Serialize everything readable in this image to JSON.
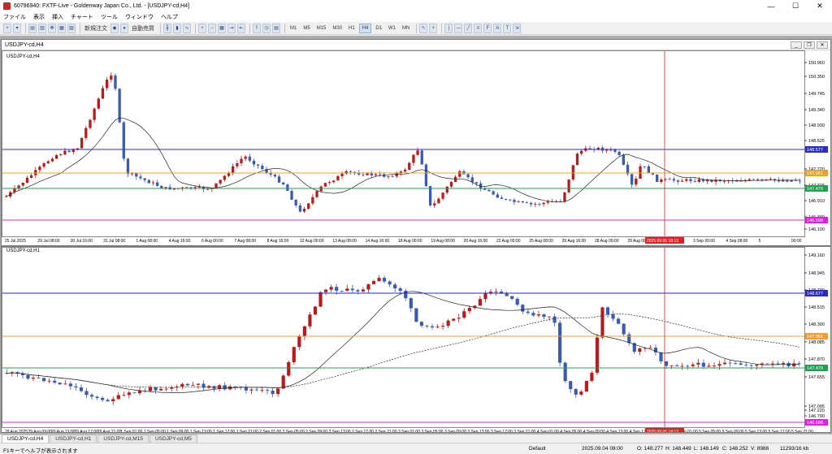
{
  "window": {
    "title": "60796940: FXTF-Live - Goldenway Japan Co., Ltd. - [USDJPY-cd,H4]"
  },
  "menu": [
    "ファイル",
    "表示",
    "挿入",
    "チャート",
    "ツール",
    "ウィンドウ",
    "ヘルプ"
  ],
  "toolbar": {
    "new_order": "新規注文",
    "auto_trade": "自動売買",
    "timeframes": [
      "M1",
      "M5",
      "M15",
      "M30",
      "H1",
      "H4",
      "D1",
      "W1",
      "MN"
    ]
  },
  "top_chart": {
    "symbol": "USDJPY-cd,H4",
    "price_labels": [
      "150.960",
      "150.350",
      "149.745",
      "149.340",
      "148.930",
      "148.525",
      "147.720",
      "147.315",
      "146.910",
      "146.300",
      "146.100"
    ],
    "level_tags": [
      {
        "text": "148.577",
        "color": "#2a2ad0"
      },
      {
        "text": "147.951",
        "color": "#f0a030"
      },
      {
        "text": "147.479",
        "color": "#20a050"
      },
      {
        "text": "146.598",
        "color": "#e020e0"
      }
    ],
    "time_labels": [
      "25 Jul 2025",
      "29 Jul 08:00",
      "30 Jul 16:00",
      "31 Jul 08:00",
      "1 Aug 08:00",
      "4 Aug 16:00",
      "6 Aug 00:00",
      "7 Aug 08:00",
      "8 Aug 16:00",
      "12 Aug 00:00",
      "13 Aug 08:00",
      "14 Aug 16:00",
      "18 Aug 00:00",
      "19 Aug 08:00",
      "20 Aug 16:00",
      "22 Aug 00:00",
      "25 Aug 08:00",
      "26 Aug 16:00",
      "28 Aug 00:00",
      "29 Aug 08:00",
      "1 Sep 16:00",
      "3 Sep 00:00",
      "4 Sep 08:00",
      "5",
      "00:00"
    ],
    "cursor_time": "2025.09.05 18:13"
  },
  "bottom_chart": {
    "symbol": "USDJPY-cd,H1",
    "price_labels": [
      "149.160",
      "148.945",
      "148.730",
      "148.515",
      "148.300",
      "148.085",
      "147.870",
      "147.655",
      "147.220",
      "147.005",
      "146.790"
    ],
    "level_tags": [
      {
        "text": "148.577",
        "color": "#2a2ad0"
      },
      {
        "text": "147.951",
        "color": "#f0a030"
      },
      {
        "text": "147.479",
        "color": "#20a050"
      },
      {
        "text": "146.598",
        "color": "#e020e0"
      }
    ],
    "time_labels": [
      "29 Aug 2025",
      "29 Aug 09:00",
      "29 Aug 13:00",
      "29 Aug 17:00",
      "29 Aug 21:00",
      "1 Sep 01:00",
      "1 Sep 05:00",
      "1 Sep 09:00",
      "1 Sep 13:00",
      "1 Sep 17:00",
      "1 Sep 21:00",
      "2 Sep 01:00",
      "2 Sep 05:00",
      "2 Sep 09:00",
      "2 Sep 13:00",
      "2 Sep 17:00",
      "2 Sep 21:00",
      "3 Sep 01:00",
      "3 Sep 05:00",
      "3 Sep 09:00",
      "3 Sep 13:00",
      "3 Sep 17:00",
      "3 Sep 21:00",
      "4 Sep 01:00",
      "4 Sep 05:00",
      "4 Sep 09:00",
      "4 Sep 13:00",
      "4 Sep 17:00",
      "4 Sep 21:00",
      "5 Sep 01:00",
      "5 Sep 05:00",
      "5 Sep 09:00",
      "5 Sep 13:00",
      "5 Sep 17:00",
      "5 Sep 21:00"
    ],
    "cursor_time": "2025.09.05 18:13"
  },
  "tabs": [
    "USDJPY-cd,H4",
    "USDJPY-cd,H1",
    "USDJPY-cd,M15",
    "USDJPY-cd,M5"
  ],
  "status": {
    "help": "F1キーでヘルプが表示されます",
    "profile": "Default",
    "datetime": "2025.09.04 08:00",
    "open": "O: 148.277",
    "high": "H: 148.449",
    "low": "L: 148.149",
    "close": "C: 148.252",
    "volume": "V: 8988",
    "traffic": "11293/16 kb"
  },
  "colors": {
    "bull": "#b71c1c",
    "bear": "#3a5bb0",
    "blue_level": "#2a2ad0",
    "orange_level": "#f0a030",
    "green_level": "#20a050",
    "magenta_level": "#e020e0",
    "cursor": "#e02020"
  }
}
